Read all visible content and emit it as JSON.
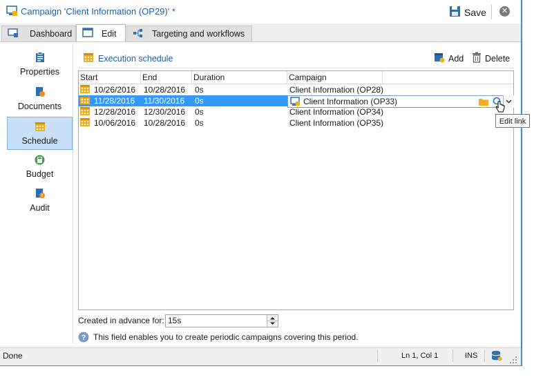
{
  "window": {
    "title": "Campaign 'Client Information (OP29)' *",
    "save_label": "Save"
  },
  "tabs": [
    {
      "label": "Dashboard"
    },
    {
      "label": "Edit"
    },
    {
      "label": "Targeting and workflows"
    }
  ],
  "sidebar": {
    "items": [
      {
        "label": "Properties",
        "icon": "clipboard-icon"
      },
      {
        "label": "Documents",
        "icon": "documents-icon"
      },
      {
        "label": "Schedule",
        "icon": "calendar-icon",
        "active": true
      },
      {
        "label": "Budget",
        "icon": "calculator-icon"
      },
      {
        "label": "Audit",
        "icon": "audit-icon"
      }
    ]
  },
  "schedule": {
    "section_label": "Execution schedule",
    "add_label": "Add",
    "delete_label": "Delete",
    "columns": [
      "Start",
      "End",
      "Duration",
      "Campaign"
    ],
    "rows": [
      {
        "start": "10/26/2016",
        "end": "10/28/2016",
        "duration": "0s",
        "campaign": "Client Information (OP28)"
      },
      {
        "start": "11/28/2016",
        "end": "11/30/2016",
        "duration": "0s",
        "campaign": "Client Information (OP33)"
      },
      {
        "start": "12/28/2016",
        "end": "12/30/2016",
        "duration": "0s",
        "campaign": "Client Information (OP34)"
      },
      {
        "start": "10/06/2016",
        "end": "10/28/2016",
        "duration": "0s",
        "campaign": "Client Information (OP35)"
      }
    ],
    "editor_value": "Client Information (OP33)",
    "tooltip": "Edit link"
  },
  "advance": {
    "label": "Created in advance for:",
    "value": "15s",
    "help": "This field enables you to create periodic campaigns covering this period."
  },
  "status": {
    "text": "Done",
    "position": "Ln 1, Col 1",
    "mode": "INS"
  },
  "colors": {
    "accent": "#3399ff",
    "title": "#1f5fa6",
    "calendar": "#f2b01e"
  }
}
